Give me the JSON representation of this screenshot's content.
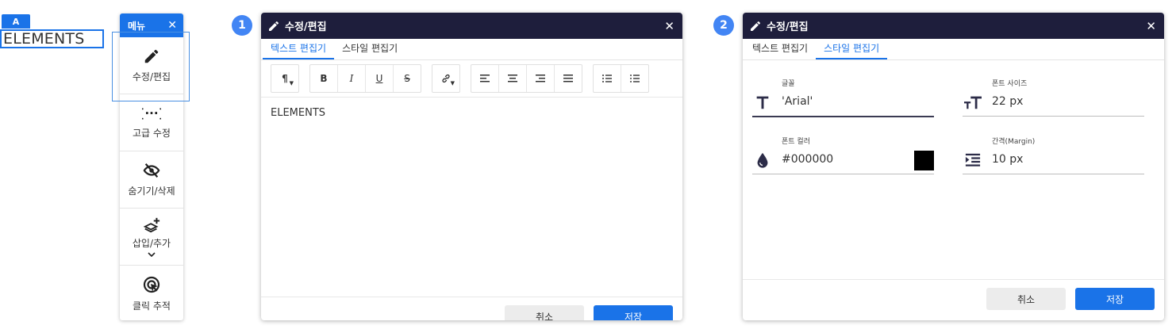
{
  "element_tag": "A",
  "selected_text": "ELEMENTS",
  "menu": {
    "title": "메뉴",
    "close": "✕",
    "items": [
      {
        "label": "수정/편집",
        "icon": "pencil-icon"
      },
      {
        "label": "고급 수정",
        "icon": "code-braces-icon"
      },
      {
        "label": "숨기기/삭제",
        "icon": "eye-off-icon"
      },
      {
        "label": "삽입/추가",
        "icon": "layers-plus-icon"
      },
      {
        "label": "클릭 추적",
        "icon": "click-target-icon"
      }
    ]
  },
  "steps": [
    "1",
    "2"
  ],
  "dialog1": {
    "title": "수정/편집",
    "tabs": [
      "텍스트 편집기",
      "스타일 편집기"
    ],
    "active_tab": 0,
    "toolbar": {
      "paragraph": "¶",
      "bold": "B",
      "italic": "I",
      "underline": "U",
      "strike": "S"
    },
    "content": "ELEMENTS",
    "cancel": "취소",
    "save": "저장"
  },
  "dialog2": {
    "title": "수정/편집",
    "tabs": [
      "텍스트 편집기",
      "스타일 편집기"
    ],
    "active_tab": 1,
    "fields": {
      "font_label": "글꼴",
      "font_value": "'Arial'",
      "size_label": "폰트 사이즈",
      "size_value": "22 px",
      "color_label": "폰트 컬러",
      "color_value": "#000000",
      "margin_label": "간격(Margin)",
      "margin_value": "10 px"
    },
    "cancel": "취소",
    "save": "저장"
  },
  "colors": {
    "accent": "#1a73e8",
    "header_dark": "#1e1e3c",
    "badge": "#4285f4",
    "swatch": "#000000"
  }
}
